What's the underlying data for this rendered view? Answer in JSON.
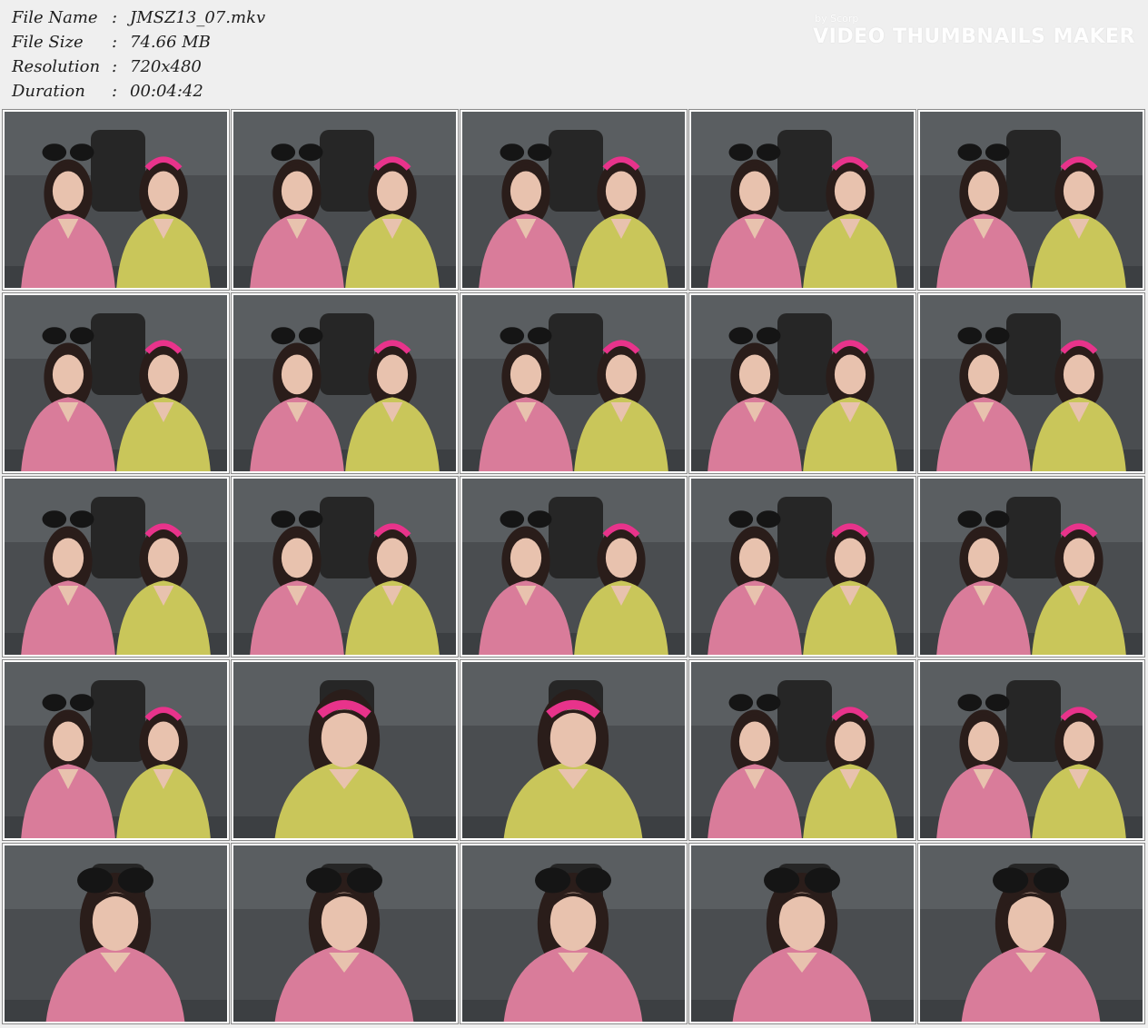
{
  "file_info": {
    "file_name_label": "File Name",
    "file_name_sep": ":",
    "file_name": "JMSZ13_07.mkv",
    "file_size_label": "File Size",
    "file_size_sep": ":",
    "file_size": "74.66 MB",
    "resolution_label": "Resolution",
    "resolution_sep": ":",
    "resolution": "720x480",
    "duration_label": "Duration",
    "duration_sep": ":",
    "duration": "00:04:42"
  },
  "watermark": {
    "byline": "by Scorp",
    "title": "VIDEO THUMBNAILS MAKER"
  },
  "thumbnails": [
    {
      "scene": "two",
      "left": "pink",
      "right": "yellow"
    },
    {
      "scene": "two",
      "left": "pink",
      "right": "yellow"
    },
    {
      "scene": "two",
      "left": "pink",
      "right": "yellow"
    },
    {
      "scene": "two",
      "left": "pink",
      "right": "yellow"
    },
    {
      "scene": "two",
      "left": "pink",
      "right": "yellow"
    },
    {
      "scene": "two",
      "left": "pink",
      "right": "yellow"
    },
    {
      "scene": "two",
      "left": "pink",
      "right": "yellow"
    },
    {
      "scene": "two",
      "left": "pink",
      "right": "yellow"
    },
    {
      "scene": "two",
      "left": "pink",
      "right": "yellow"
    },
    {
      "scene": "two",
      "left": "pink",
      "right": "yellow"
    },
    {
      "scene": "two",
      "left": "pink",
      "right": "yellow"
    },
    {
      "scene": "two",
      "left": "pink",
      "right": "yellow"
    },
    {
      "scene": "two",
      "left": "pink",
      "right": "yellow"
    },
    {
      "scene": "two",
      "left": "pink",
      "right": "yellow"
    },
    {
      "scene": "two",
      "left": "pink",
      "right": "yellow"
    },
    {
      "scene": "two",
      "left": "pink",
      "right": "yellow"
    },
    {
      "scene": "solo",
      "left": "yellow"
    },
    {
      "scene": "solo",
      "left": "yellow"
    },
    {
      "scene": "two",
      "left": "pink",
      "right": "yellow"
    },
    {
      "scene": "two",
      "left": "pink",
      "right": "yellow"
    },
    {
      "scene": "solo",
      "left": "pink"
    },
    {
      "scene": "solo",
      "left": "pink"
    },
    {
      "scene": "solo",
      "left": "pink"
    },
    {
      "scene": "solo",
      "left": "pink"
    },
    {
      "scene": "solo",
      "left": "pink"
    }
  ],
  "colors": {
    "pink_robe": "#d97c9a",
    "yellow_robe": "#c9c65a",
    "headband": "#e8338b",
    "background": "#4a4d50",
    "hair": "#2a1d1a",
    "skin": "#e8c2ae"
  }
}
